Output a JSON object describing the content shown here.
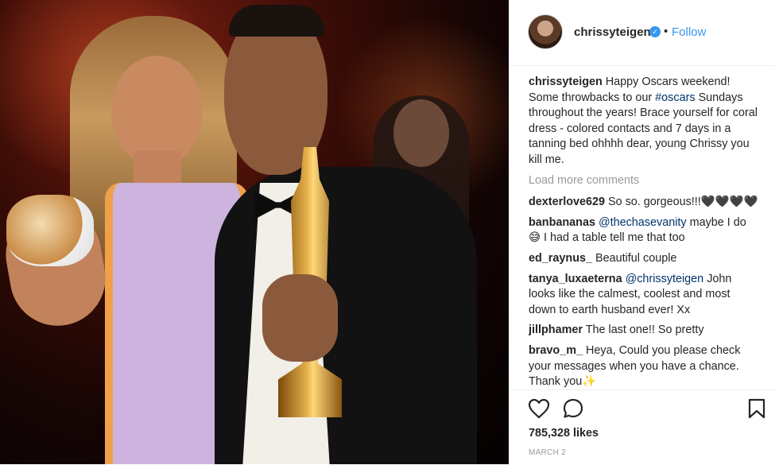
{
  "post": {
    "author": {
      "username": "chrissyteigen",
      "separator": "•",
      "follow_label": "Follow",
      "verified_icon": "verified-badge-icon"
    },
    "caption": {
      "username": "chrissyteigen",
      "text_before": "Happy Oscars weekend! Some throwbacks to our",
      "hashtag": "#oscars",
      "text_after": "Sundays throughout the years! Brace yourself for coral dress - colored contacts and 7 days in a tanning bed ohhhh dear, young Chrissy you kill me."
    },
    "load_more_label": "Load more comments",
    "comments": [
      {
        "username": "dexterlove629",
        "mention": "",
        "text": "So so. gorgeous!!!🖤🖤🖤🖤"
      },
      {
        "username": "banbananas",
        "mention": "@thechasevanity",
        "text": "maybe I do 😅 I had a table tell me that too"
      },
      {
        "username": "ed_raynus_",
        "mention": "",
        "text": "Beautiful couple"
      },
      {
        "username": "tanya_luxaeterna",
        "mention": "@chrissyteigen",
        "text": "John looks like the calmest, coolest and most down to earth husband ever! Xx"
      },
      {
        "username": "jillphamer",
        "mention": "",
        "text": "The last one!! So pretty"
      },
      {
        "username": "bravo_m_",
        "mention": "",
        "text": "Heya, Could you please check your messages when you have a chance. Thank you✨"
      }
    ],
    "likes": "785,328 likes",
    "date": "MARCH 2",
    "colors": {
      "link": "#3897f0",
      "text": "#262626",
      "muted": "#999999",
      "mention": "#003569"
    }
  }
}
